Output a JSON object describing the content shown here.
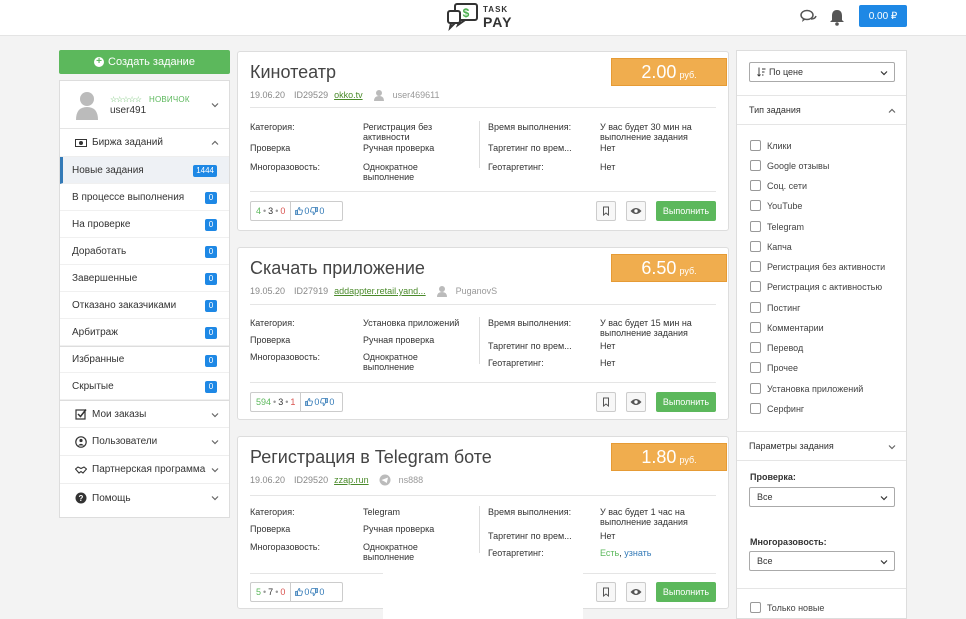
{
  "header": {
    "logo_top": "TASK",
    "logo_bottom": "PAY",
    "balance": "0.00 ₽"
  },
  "sidebar": {
    "create_label": "Создать задание",
    "rank": "НОВИЧОК",
    "stars": "☆☆☆☆☆",
    "username": "user491",
    "exchange_label": "Биржа заданий",
    "items": [
      {
        "label": "Новые задания",
        "badge": "1444"
      },
      {
        "label": "В процессе выполнения",
        "badge": "0"
      },
      {
        "label": "На проверке",
        "badge": "0"
      },
      {
        "label": "Доработать",
        "badge": "0"
      },
      {
        "label": "Завершенные",
        "badge": "0"
      },
      {
        "label": "Отказано заказчиками",
        "badge": "0"
      },
      {
        "label": "Арбитраж",
        "badge": "0"
      },
      {
        "label": "Избранные",
        "badge": "0"
      },
      {
        "label": "Скрытые",
        "badge": "0"
      }
    ],
    "sections": [
      "Мои заказы",
      "Пользователи",
      "Партнерская программа",
      "Помощь"
    ]
  },
  "labels": {
    "category": "Категория:",
    "check": "Проверка",
    "reuse": "Многоразовость:",
    "exec_time": "Время выполнения:",
    "targeting": "Таргетинг по врем...",
    "geo": "Геотаргетинг:",
    "currency": "руб.",
    "do": "Выполнить"
  },
  "tasks": [
    {
      "title": "Кинотеатр",
      "price": "2.00",
      "date": "19.06.20",
      "id": "ID29529",
      "site": "okko.tv",
      "author": "user469611",
      "category": "Регистрация без активности",
      "check": "Ручная проверка",
      "reuse": "Однократное выполнение",
      "exec_time": "У вас будет 30 мин на выполнение задания",
      "targeting": "Нет",
      "geo": "Нет",
      "stat_g": "4",
      "stat_k": "3",
      "stat_r": "0",
      "likes": "0",
      "dislikes": "0"
    },
    {
      "title": "Скачать приложение",
      "price": "6.50",
      "date": "19.05.20",
      "id": "ID27919",
      "site": "addappter.retail.yand...",
      "author": "PuganovS",
      "category": "Установка приложений",
      "check": "Ручная проверка",
      "reuse": "Однократное выполнение",
      "exec_time": "У вас будет 15 мин на выполнение задания",
      "targeting": "Нет",
      "geo": "Нет",
      "stat_g": "594",
      "stat_k": "3",
      "stat_r": "1",
      "likes": "0",
      "dislikes": "0"
    },
    {
      "title": "Регистрация в Telegram боте",
      "price": "1.80",
      "date": "19.06.20",
      "id": "ID29520",
      "site": "zzap.run",
      "author": "ns888",
      "category": "Telegram",
      "check": "Ручная проверка",
      "reuse": "Однократное выполнение",
      "exec_time": "У вас будет 1 час на выполнение задания",
      "targeting": "Нет",
      "geo_yes": "Есть",
      "geo_sep": ",",
      "geo_link": "узнать",
      "stat_g": "5",
      "stat_k": "7",
      "stat_r": "0",
      "likes": "0",
      "dislikes": "0"
    }
  ],
  "filters": {
    "sort": "По цене",
    "type_head": "Тип задания",
    "types": [
      "Клики",
      "Google отзывы",
      "Соц. сети",
      "YouTube",
      "Telegram",
      "Капча",
      "Регистрация без активности",
      "Регистрация с активностью",
      "Постинг",
      "Комментарии",
      "Перевод",
      "Прочее",
      "Установка приложений",
      "Серфинг"
    ],
    "params_head": "Параметры задания",
    "check_label": "Проверка:",
    "check_value": "Все",
    "reuse_label": "Многоразовость:",
    "reuse_value": "Все",
    "only_new": "Только новые"
  }
}
